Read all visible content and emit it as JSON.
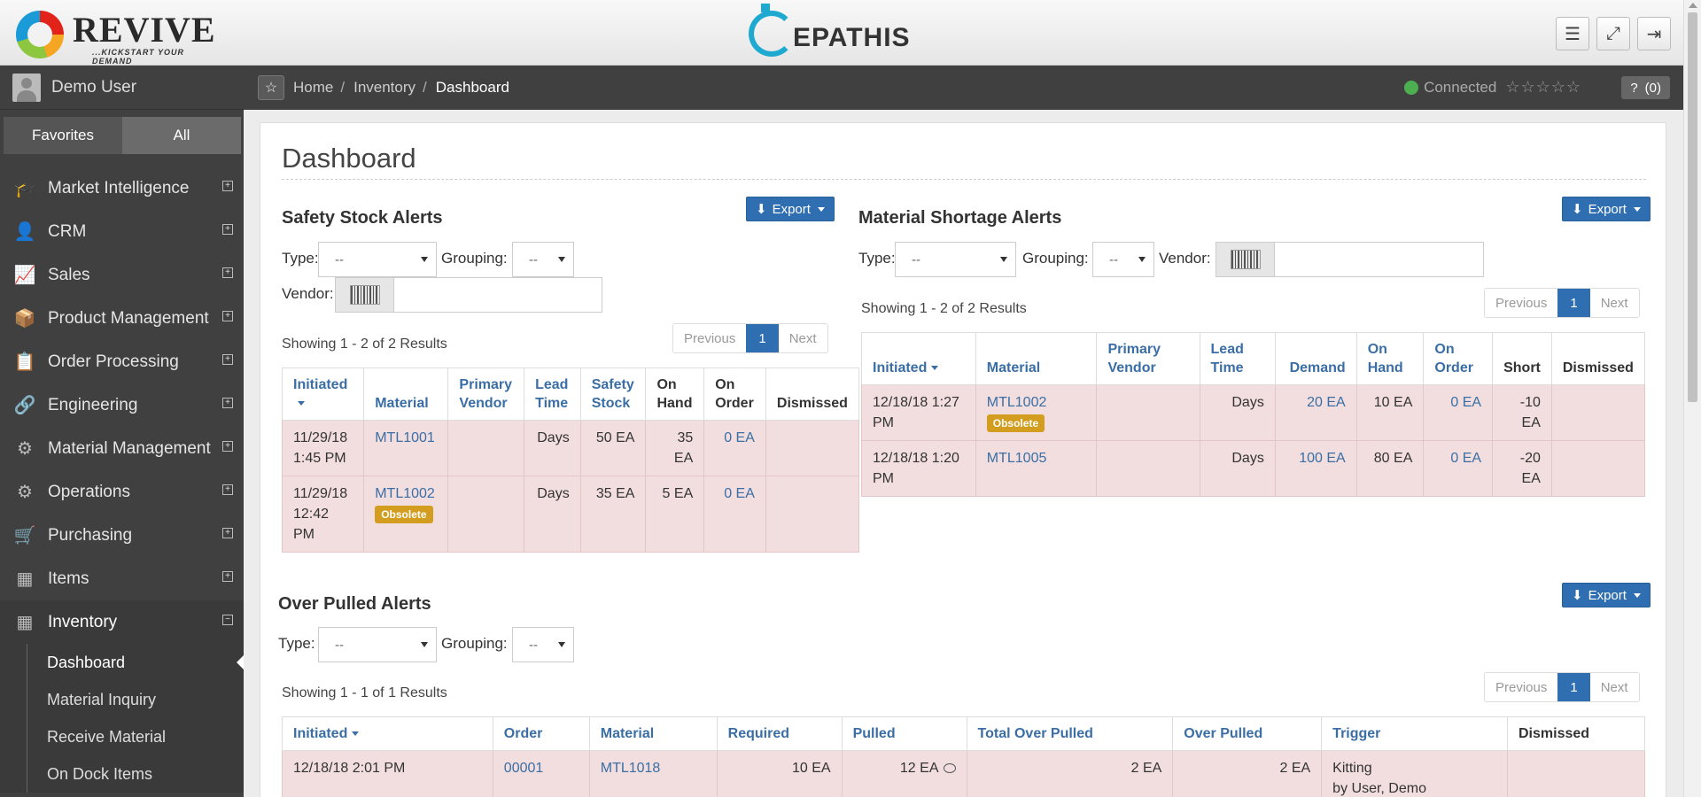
{
  "header": {
    "brand_left": "REVIVE",
    "brand_left_tagline": "...KICKSTART YOUR DEMAND",
    "brand_center": "EPATHIS",
    "buttons": [
      {
        "name": "menu-icon",
        "glyph": "☰"
      },
      {
        "name": "fullscreen-icon",
        "glyph": "⤢"
      },
      {
        "name": "logout-icon",
        "glyph": "⇥"
      }
    ]
  },
  "sidebar": {
    "user_name": "Demo User",
    "tabs": [
      "Favorites",
      "All"
    ],
    "items": [
      {
        "label": "Market Intelligence",
        "icon": "graduation-cap-icon",
        "glyph": "🎓"
      },
      {
        "label": "CRM",
        "icon": "user-icon",
        "glyph": "👤"
      },
      {
        "label": "Sales",
        "icon": "line-chart-icon",
        "glyph": "📈"
      },
      {
        "label": "Product Management",
        "icon": "cube-icon",
        "glyph": "📦"
      },
      {
        "label": "Order Processing",
        "icon": "copy-icon",
        "glyph": "📋"
      },
      {
        "label": "Engineering",
        "icon": "link-icon",
        "glyph": "🔗"
      },
      {
        "label": "Material Management",
        "icon": "sitemap-icon",
        "glyph": "⚙"
      },
      {
        "label": "Operations",
        "icon": "gears-icon",
        "glyph": "⚙"
      },
      {
        "label": "Purchasing",
        "icon": "cart-icon",
        "glyph": "🛒"
      },
      {
        "label": "Items",
        "icon": "cubes-icon",
        "glyph": "▦"
      },
      {
        "label": "Inventory",
        "icon": "cubes-icon",
        "glyph": "▦"
      }
    ],
    "inventory_sub": [
      "Dashboard",
      "Material Inquiry",
      "Receive Material",
      "On Dock Items"
    ]
  },
  "breadcrumb": {
    "home": "Home",
    "inventory": "Inventory",
    "current": "Dashboard",
    "sep": "/",
    "status": "Connected",
    "stars": "☆☆☆☆☆",
    "help": "?",
    "help_count": "(0)"
  },
  "page": {
    "title": "Dashboard"
  },
  "common": {
    "export": "Export",
    "type_label": "Type:",
    "grouping_label": "Grouping:",
    "vendor_label": "Vendor:",
    "select_default": "--",
    "previous": "Previous",
    "next": "Next",
    "page": "1"
  },
  "safety": {
    "title": "Safety Stock Alerts",
    "showing": "Showing 1 - 2 of 2 Results",
    "headers": [
      "Initiated",
      "Material",
      "Primary Vendor",
      "Lead Time",
      "Safety Stock",
      "On Hand",
      "On Order",
      "Dismissed"
    ],
    "rows": [
      {
        "initiated": "11/29/18 1:45 PM",
        "material": "MTL1001",
        "vendor": "",
        "lead": "Days",
        "safety": "50 EA",
        "onhand": "35 EA",
        "onorder": "0 EA",
        "badge": ""
      },
      {
        "initiated": "11/29/18 12:42 PM",
        "material": "MTL1002",
        "vendor": "",
        "lead": "Days",
        "safety": "35 EA",
        "onhand": "5 EA",
        "onorder": "0 EA",
        "badge": "Obsolete"
      }
    ]
  },
  "shortage": {
    "title": "Material Shortage Alerts",
    "showing": "Showing 1 - 2 of 2 Results",
    "headers": [
      "Initiated",
      "Material",
      "Primary Vendor",
      "Lead Time",
      "Demand",
      "On Hand",
      "On Order",
      "Short",
      "Dismissed"
    ],
    "rows": [
      {
        "initiated": "12/18/18 1:27 PM",
        "material": "MTL1002",
        "vendor": "",
        "lead": "Days",
        "demand": "20 EA",
        "onhand": "10 EA",
        "onorder": "0 EA",
        "short": "-10 EA",
        "badge": "Obsolete"
      },
      {
        "initiated": "12/18/18 1:20 PM",
        "material": "MTL1005",
        "vendor": "",
        "lead": "Days",
        "demand": "100 EA",
        "onhand": "80 EA",
        "onorder": "0 EA",
        "short": "-20 EA",
        "badge": ""
      }
    ]
  },
  "overpulled": {
    "title": "Over Pulled Alerts",
    "showing": "Showing 1 - 1 of 1 Results",
    "headers": [
      "Initiated",
      "Order",
      "Material",
      "Required",
      "Pulled",
      "Total Over Pulled",
      "Over Pulled",
      "Trigger",
      "Dismissed"
    ],
    "rows": [
      {
        "initiated": "12/18/18 2:01 PM",
        "order": "00001",
        "material": "MTL1018",
        "required": "10 EA",
        "pulled": "12 EA",
        "total_over": "2 EA",
        "over": "2 EA",
        "trigger": "Kitting",
        "trigger_by": "by User, Demo"
      }
    ]
  }
}
